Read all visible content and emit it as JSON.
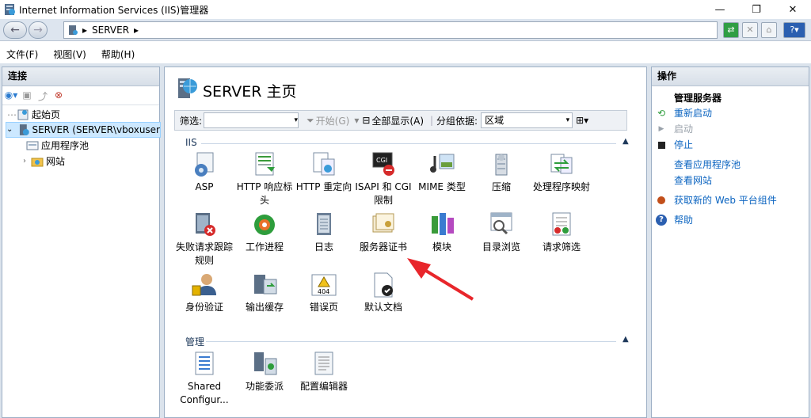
{
  "window": {
    "title": "Internet Information Services (IIS)管理器"
  },
  "address": {
    "breadcrumb": [
      "SERVER"
    ]
  },
  "menu": {
    "items": [
      "文件(F)",
      "视图(V)",
      "帮助(H)"
    ]
  },
  "connections": {
    "header": "连接",
    "tree": [
      {
        "label": "起始页"
      },
      {
        "label": "SERVER (SERVER\\vboxuser"
      },
      {
        "label": "应用程序池"
      },
      {
        "label": "网站"
      }
    ]
  },
  "main": {
    "title": "SERVER 主页",
    "filter": {
      "label": "筛选:",
      "start": "开始(G)",
      "show_all": "全部显示(A)",
      "group_by_label": "分组依据:",
      "group_by_value": "区域"
    },
    "groups": [
      {
        "name": "IIS",
        "features": [
          "ASP",
          "HTTP 响应标头",
          "HTTP 重定向",
          "ISAPI 和 CGI 限制",
          "MIME 类型",
          "压缩",
          "处理程序映射",
          "失败请求跟踪规则",
          "工作进程",
          "日志",
          "服务器证书",
          "模块",
          "目录浏览",
          "请求筛选",
          "身份验证",
          "输出缓存",
          "错误页",
          "默认文档"
        ]
      },
      {
        "name": "管理",
        "features": [
          "Shared Configur...",
          "功能委派",
          "配置编辑器"
        ]
      }
    ]
  },
  "actions": {
    "header": "操作",
    "group_title": "管理服务器",
    "items": [
      "重新启动",
      "启动",
      "停止",
      "查看应用程序池",
      "查看网站",
      "获取新的 Web 平台组件",
      "帮助"
    ]
  },
  "colors": {
    "accent_link": "#0b64c0",
    "annotation_arrow": "#e8262b",
    "selection": "#cce8ff"
  }
}
